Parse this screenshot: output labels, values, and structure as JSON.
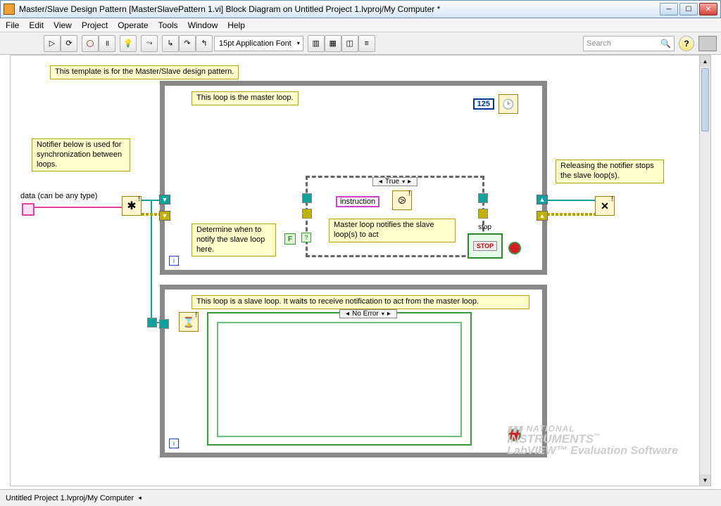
{
  "window": {
    "title": "Master/Slave Design Pattern [MasterSlavePattern 1.vi] Block Diagram on Untitled Project 1.lvproj/My Computer *"
  },
  "menu": [
    "File",
    "Edit",
    "View",
    "Project",
    "Operate",
    "Tools",
    "Window",
    "Help"
  ],
  "toolbar": {
    "font": "15pt Application Font",
    "search_placeholder": "Search",
    "help": "?"
  },
  "notes": {
    "template": "This template is for the Master/Slave design pattern.",
    "master": "This loop is the master loop.",
    "notifier": "Notifier below is used for synchronization between loops.",
    "release": "Releasing the notifier stops the slave loop(s).",
    "determine": "Determine when to notify the slave loop here.",
    "mnotify": "Master loop notifies the slave loop(s) to act",
    "slave": "This loop is a slave loop. It waits to receive notification to act from the master loop."
  },
  "diagram": {
    "timeout": "125",
    "data_label": "data (can be any type)",
    "case_true": "True",
    "case_noerror": "No Error",
    "instruction": "instruction",
    "stop_label": "stop",
    "stop_text": "STOP",
    "bool_false": "F",
    "loop_i": "i"
  },
  "status": "Untitled Project 1.lvproj/My Computer",
  "watermark": {
    "l1": "NATIONAL",
    "l2": "INSTRUMENTS",
    "l3": "LabVIEW™ Evaluation Software"
  }
}
